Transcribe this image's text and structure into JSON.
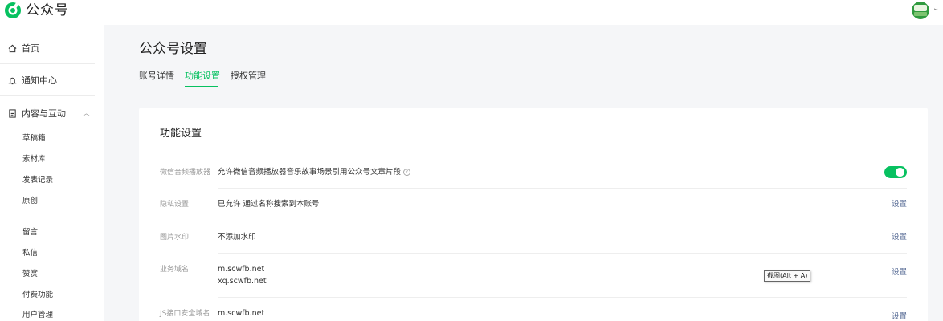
{
  "header": {
    "app_title": "公众号"
  },
  "sidebar": {
    "home": "首页",
    "notifications": "通知中心",
    "content_section": "内容与互动",
    "content_items": [
      "草稿箱",
      "素材库",
      "发表记录",
      "原创"
    ],
    "interaction_items": [
      "留言",
      "私信",
      "赞赏",
      "付费功能",
      "用户管理"
    ]
  },
  "main": {
    "page_title": "公众号设置",
    "tabs": [
      {
        "label": "账号详情",
        "active": false
      },
      {
        "label": "功能设置",
        "active": true
      },
      {
        "label": "授权管理",
        "active": false
      }
    ]
  },
  "card": {
    "title": "功能设置",
    "rows": [
      {
        "label": "微信音频播放器",
        "value": "允许微信音频播放器音乐故事场景引用公众号文章片段",
        "help": "?",
        "toggle_on": true
      },
      {
        "label": "隐私设置",
        "value": "已允许 通过名称搜索到本账号",
        "action": "设置"
      },
      {
        "label": "图片水印",
        "value": "不添加水印",
        "action": "设置"
      },
      {
        "label": "业务域名",
        "value_lines": [
          "m.scwfb.net",
          "xq.scwfb.net"
        ],
        "action": "设置"
      },
      {
        "label": "JS接口安全域名",
        "value": "m.scwfb.net",
        "action": "设置"
      }
    ]
  },
  "tooltip": {
    "text": "截图(Alt + A)"
  },
  "colors": {
    "accent": "#07c160",
    "link": "#576b95"
  }
}
